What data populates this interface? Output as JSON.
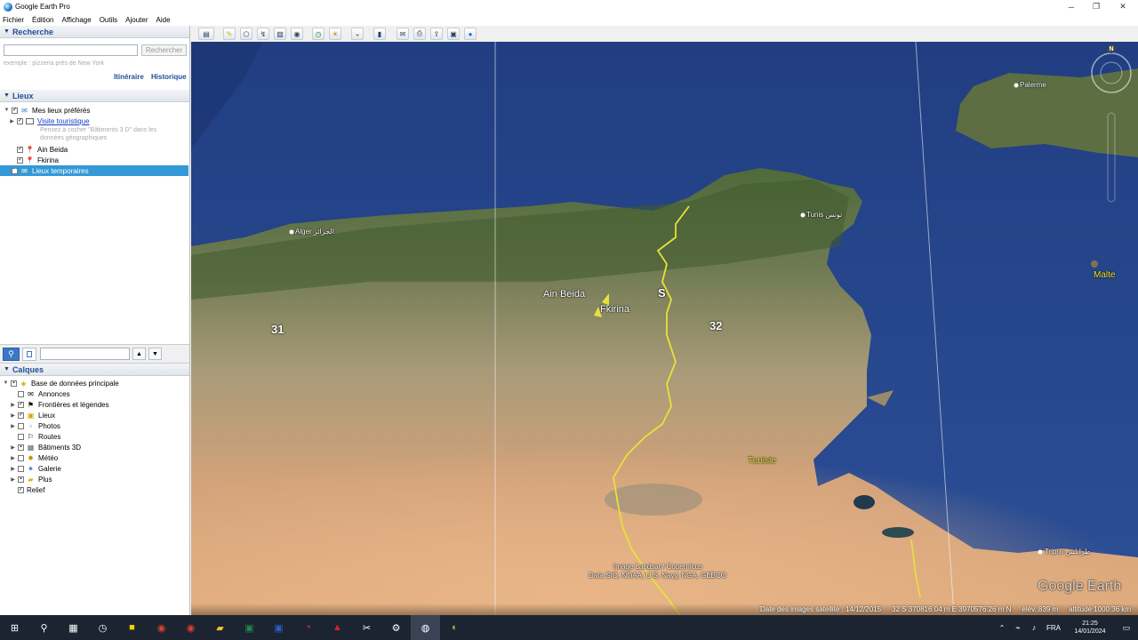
{
  "window": {
    "title": "Google Earth Pro",
    "controls": [
      "─",
      "❐",
      "✕"
    ]
  },
  "menu": [
    "Fichier",
    "Édition",
    "Affichage",
    "Outils",
    "Ajouter",
    "Aide"
  ],
  "search": {
    "header": "Recherche",
    "input_value": "",
    "button": "Rechercher",
    "hint": "exemple : pizzeria près de New York",
    "links": [
      "Itinéraire",
      "Historique"
    ]
  },
  "places": {
    "header": "Lieux",
    "items": [
      {
        "label": "Mes lieux préférés"
      },
      {
        "label": "Visite touristique",
        "note": "Pensez à cocher \"Bâtiments 3 D\" dans les données géographiques"
      },
      {
        "label": "Ain Beida"
      },
      {
        "label": "Fkirina"
      },
      {
        "label": "Lieux temporaires"
      }
    ]
  },
  "layers": {
    "header": "Calques",
    "items": [
      {
        "label": "Base de données principale"
      },
      {
        "label": "Annonces"
      },
      {
        "label": "Frontières et légendes"
      },
      {
        "label": "Lieux"
      },
      {
        "label": "Photos"
      },
      {
        "label": "Routes"
      },
      {
        "label": "Bâtiments 3D"
      },
      {
        "label": "Météo"
      },
      {
        "label": "Galerie"
      },
      {
        "label": "Plus"
      },
      {
        "label": "Relief"
      }
    ]
  },
  "map": {
    "places": {
      "alger": "Alger الجزائر",
      "tunis": "Tunis تونس",
      "palerme": "Palerme",
      "malte": "Malte",
      "tunisie": "Tunisie",
      "tripoli": "Tripoli طرابلس",
      "ain_beida": "Ain Beida",
      "fkirina": "Fkirina"
    },
    "zone_labels": {
      "z31": "31",
      "z32": "32",
      "s": "S"
    },
    "compass_n": "N",
    "attribution": [
      "Image Landsat / Copernicus",
      "Data SIO, NOAA, U.S. Navy, NGA, GEBCO"
    ],
    "logo": "Google Earth",
    "status": {
      "date": "Date des images satellite : 14/12/2015",
      "coords": "32 S 370816.04 m E 3970576.26 m N",
      "elev": "élév.  839 m",
      "alt": "altitude 1000.36 km"
    }
  },
  "taskbar": {
    "lang": "FRA",
    "time": "21:25",
    "date": "14/01/2024"
  }
}
